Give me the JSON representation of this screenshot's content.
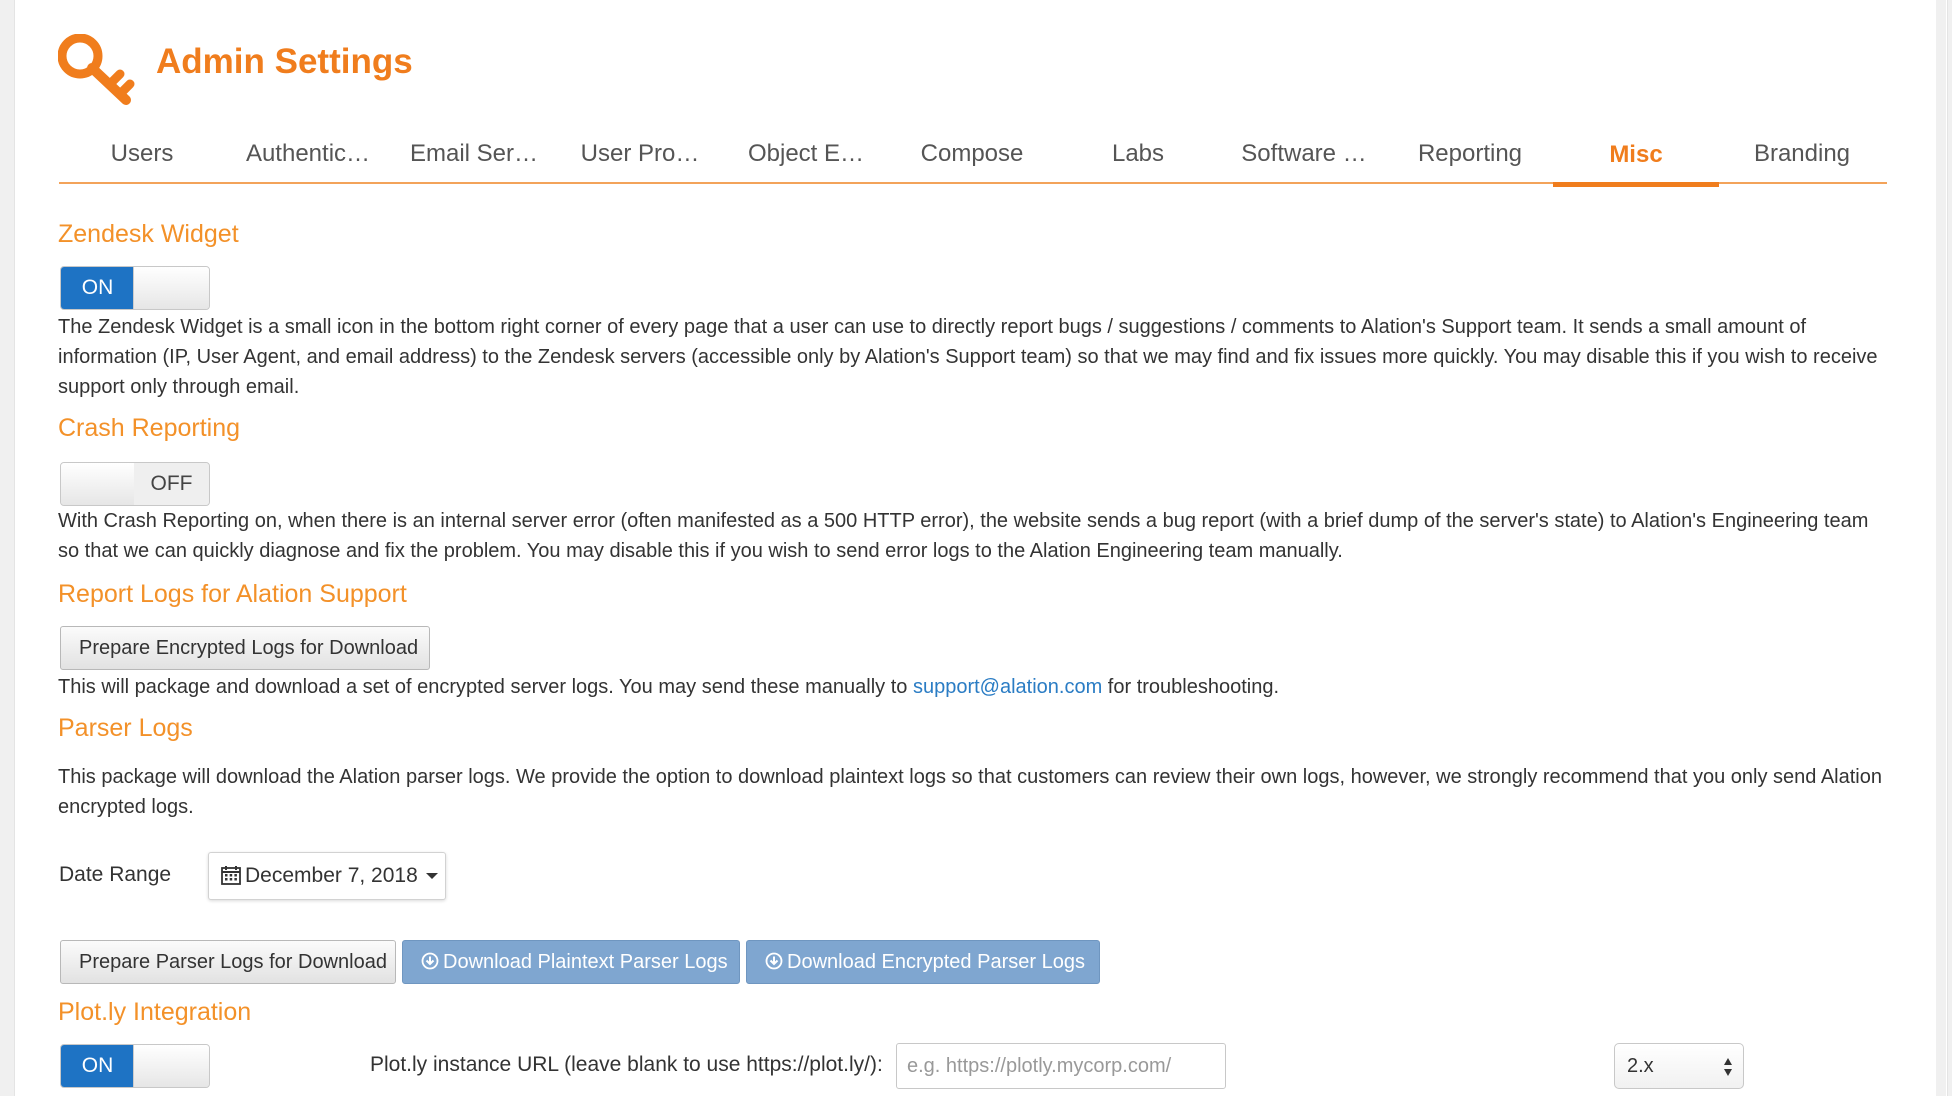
{
  "header": {
    "title": "Admin Settings",
    "icon": "key-icon"
  },
  "tabs": [
    {
      "label": "Users"
    },
    {
      "label": "Authentic…"
    },
    {
      "label": "Email Ser…"
    },
    {
      "label": "User Pro…"
    },
    {
      "label": "Object E…"
    },
    {
      "label": "Compose"
    },
    {
      "label": "Labs"
    },
    {
      "label": "Software …"
    },
    {
      "label": "Reporting"
    },
    {
      "label": "Misc",
      "active": true
    },
    {
      "label": "Branding"
    }
  ],
  "zendesk": {
    "title": "Zendesk Widget",
    "toggle": {
      "state": "ON",
      "label": "ON"
    },
    "description": "The Zendesk Widget is a small icon in the bottom right corner of every page that a user can use to directly report bugs / suggestions / comments to Alation's Support team. It sends a small amount of information (IP, User Agent, and email address) to the Zendesk servers (accessible only by Alation's Support team) so that we may find and fix issues more quickly. You may disable this if you wish to receive support only through email."
  },
  "crash": {
    "title": "Crash Reporting",
    "toggle": {
      "state": "OFF",
      "label": "OFF"
    },
    "description": "With Crash Reporting on, when there is an internal server error (often manifested as a 500 HTTP error), the website sends a bug report (with a brief dump of the server's state) to Alation's Engineering team so that we can quickly diagnose and fix the problem. You may disable this if you wish to send error logs to the Alation Engineering team manually."
  },
  "report_logs": {
    "title": "Report Logs for Alation Support",
    "button": "Prepare Encrypted Logs for Download",
    "desc_before": "This will package and download a set of encrypted server logs. You may send these manually to ",
    "link": "support@alation.com",
    "desc_after": " for troubleshooting."
  },
  "parser_logs": {
    "title": "Parser Logs",
    "description": "This package will download the Alation parser logs. We provide the option to download plaintext logs so that customers can review their own logs, however, we strongly recommend that you only send Alation encrypted logs.",
    "date_range_label": "Date Range",
    "date_value": "December 7, 2018",
    "btn_prepare": "Prepare Parser Logs for Download",
    "btn_plaintext": "Download Plaintext Parser Logs",
    "btn_encrypted": "Download Encrypted Parser Logs"
  },
  "plotly": {
    "title": "Plot.ly Integration",
    "toggle": {
      "state": "ON",
      "label": "ON"
    },
    "url_label": "Plot.ly instance URL (leave blank to use https://plot.ly/):",
    "url_placeholder": "e.g. https://plotly.mycorp.com/",
    "version_selected": "2.x"
  },
  "colors": {
    "accent": "#f07d1d",
    "toggle_on": "#1e73c4",
    "primary_button": "#7fa6d0",
    "link": "#2a7cc4"
  }
}
